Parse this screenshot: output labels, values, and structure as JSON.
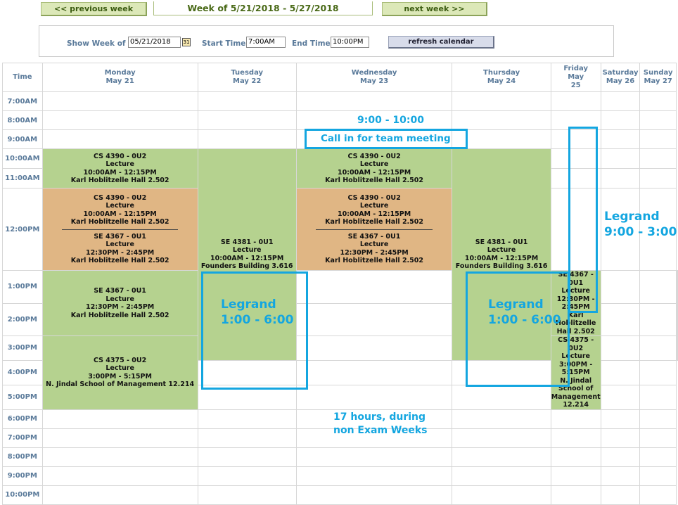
{
  "nav": {
    "prev_label": "<< previous week",
    "week_title": "Week of 5/21/2018 - 5/27/2018",
    "next_label": "next week >>"
  },
  "filters": {
    "show_week_label": "Show Week of",
    "show_week_value": "05/21/2018",
    "start_time_label": "Start Time",
    "start_time_value": "7:00AM",
    "end_time_label": "End Time",
    "end_time_value": "10:00PM",
    "refresh_label": "refresh calendar"
  },
  "columns": {
    "time": "Time",
    "days": [
      {
        "name": "Monday",
        "date": "May 21"
      },
      {
        "name": "Tuesday",
        "date": "May 22"
      },
      {
        "name": "Wednesday",
        "date": "May 23"
      },
      {
        "name": "Thursday",
        "date": "May 24"
      },
      {
        "name": "Friday",
        "date": "May",
        "date2": "25"
      },
      {
        "name": "Saturday",
        "date": "May 26"
      },
      {
        "name": "Sunday",
        "date": "May 27"
      }
    ]
  },
  "times": [
    "7:00AM",
    "8:00AM",
    "9:00AM",
    "10:00AM",
    "11:00AM",
    "12:00PM",
    "1:00PM",
    "2:00PM",
    "3:00PM",
    "4:00PM",
    "5:00PM",
    "6:00PM",
    "7:00PM",
    "8:00PM",
    "9:00PM",
    "10:00PM"
  ],
  "events": {
    "cs4390_mon": {
      "course": "CS 4390 - 0U2",
      "type": "Lecture",
      "time": "10:00AM - 12:15PM",
      "room": "Karl Hoblitzelle Hall 2.502"
    },
    "cs4390_mon_b": {
      "course": "CS 4390 - 0U2",
      "type": "Lecture",
      "time": "10:00AM - 12:15PM",
      "room": "Karl Hoblitzelle Hall 2.502"
    },
    "se4367_mon_a": {
      "course": "SE 4367 - 0U1",
      "type": "Lecture",
      "time": "12:30PM - 2:45PM",
      "room": "Karl Hoblitzelle Hall 2.502"
    },
    "se4367_mon_b": {
      "course": "SE 4367 - 0U1",
      "type": "Lecture",
      "time": "12:30PM - 2:45PM",
      "room": "Karl Hoblitzelle Hall 2.502"
    },
    "cs4375_mon": {
      "course": "CS 4375 - 0U2",
      "type": "Lecture",
      "time": "3:00PM - 5:15PM",
      "room": "N. Jindal School of Management 12.214"
    },
    "se4381_tue": {
      "course": "SE 4381 - 0U1",
      "type": "Lecture",
      "time": "10:00AM - 12:15PM",
      "room": "Founders Building 3.616"
    },
    "cs4390_wed": {
      "course": "CS 4390 - 0U2",
      "type": "Lecture",
      "time": "10:00AM - 12:15PM",
      "room": "Karl Hoblitzelle Hall 2.502"
    },
    "cs4390_wed_b": {
      "course": "CS 4390 - 0U2",
      "type": "Lecture",
      "time": "10:00AM - 12:15PM",
      "room": "Karl Hoblitzelle Hall 2.502"
    },
    "se4367_wed_a": {
      "course": "SE 4367 - 0U1",
      "type": "Lecture",
      "time": "12:30PM - 2:45PM",
      "room": "Karl Hoblitzelle Hall 2.502"
    },
    "se4367_wed_b": {
      "course": "SE 4367 - 0U1",
      "type": "Lecture",
      "time": "12:30PM - 2:45PM",
      "room": "Karl Hoblitzelle Hall 2.502"
    },
    "cs4375_wed": {
      "course": "CS 4375 - 0U2",
      "type": "Lecture",
      "time": "3:00PM - 5:15PM",
      "room": "N. Jindal School of Management 12.214"
    },
    "se4381_thu": {
      "course": "SE 4381 - 0U1",
      "type": "Lecture",
      "time": "10:00AM - 12:15PM",
      "room": "Founders Building 3.616"
    }
  },
  "annotations": {
    "wed_time": "9:00 - 10:00",
    "wed_meeting": "Call in for team meeting",
    "fri_line1": "Legrand",
    "fri_line2": "9:00 - 3:00",
    "tue_line1": "Legrand",
    "tue_line2": "1:00 - 6:00",
    "thu_line1": "Legrand",
    "thu_line2": "1:00 - 6:00",
    "note_line1": "17 hours, during",
    "note_line2": "non Exam Weeks"
  },
  "colors": {
    "class_green": "#b5d28f",
    "overlap_orange": "#e0b684",
    "annotation_blue": "#14a6e0",
    "header_text": "#5a7a9a"
  }
}
